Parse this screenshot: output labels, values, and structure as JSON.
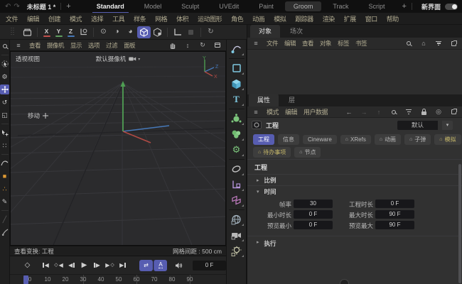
{
  "title_bar": {
    "doc_tab": "未标题 1 *",
    "add_tab": "+",
    "tabs": [
      "Standard",
      "Model",
      "Sculpt",
      "UVEdit",
      "Paint",
      "Groom",
      "Track",
      "Script"
    ],
    "add_layout": "+",
    "new_ui_label": "新界面"
  },
  "menu_bar": {
    "items": [
      "文件",
      "编辑",
      "创建",
      "模式",
      "选择",
      "工具",
      "样条",
      "网格",
      "体积",
      "运动图形",
      "角色",
      "动画",
      "模拟",
      "跟踪器",
      "渲染",
      "扩展",
      "窗口",
      "帮助"
    ]
  },
  "toolbar": {
    "axis_x": "X",
    "axis_y": "Y",
    "axis_z": "Z"
  },
  "viewport": {
    "menu": [
      "查看",
      "摄像机",
      "显示",
      "选项",
      "过滤",
      "面板"
    ],
    "view_label": "透视视图",
    "camera_label": "默认摄像机",
    "tool_hint": "移动",
    "gizmo": {
      "x": "X",
      "y": "Y",
      "z": "Z"
    },
    "status_left": "查看变换: 工程",
    "status_right": "网格间距 : 500 cm"
  },
  "object_manager": {
    "tabs": [
      "对象",
      "场次"
    ],
    "menu": [
      "文件",
      "编辑",
      "查看",
      "对象",
      "标签",
      "书签"
    ]
  },
  "attributes": {
    "tabs": [
      "属性",
      "层"
    ],
    "menu": [
      "模式",
      "编辑",
      "用户数据"
    ],
    "object_label": "工程",
    "preset_value": "默认",
    "mode_tabs": [
      "工程",
      "信息",
      "Cineware",
      "XRefs",
      "动画",
      "子弹",
      "模拟",
      "待办事项",
      "节点"
    ],
    "section_title": "工程",
    "group_scale": "比例",
    "group_time": "时间",
    "group_exec": "执行",
    "fields": {
      "fps_label": "帧率",
      "fps_value": "30",
      "proj_len_label": "工程时长",
      "proj_len_value": "0 F",
      "min_label": "最小时长",
      "min_value": "0 F",
      "max_label": "最大时长",
      "max_value": "90 F",
      "pre_min_label": "预览最小",
      "pre_min_value": "0 F",
      "pre_max_label": "预览最大",
      "pre_max_value": "90 F"
    }
  },
  "timeline": {
    "frame_value": "0 F",
    "ticks": [
      "0",
      "10",
      "20",
      "30",
      "40",
      "50",
      "60",
      "70",
      "80",
      "90"
    ]
  },
  "icons": {
    "undo": "↶",
    "redo": "↷",
    "hamburger": "≡",
    "home": "⌂",
    "gear": "⚙",
    "rotate": "↺",
    "rotate_cw": "↻",
    "dolly": "↕",
    "back": "←",
    "forward": "→",
    "up": "↑",
    "target": "◎",
    "dropdown": "▾",
    "collapsed": "▸",
    "expanded": "▾",
    "play": "▶",
    "rev": "◀",
    "diamond": "◇",
    "key_diamond": "◆",
    "loop": "⇄",
    "circle_dot": "⊙",
    "circle_half": "◑",
    "circle_most": "◕",
    "scale_sq": "◱",
    "dots": "∷",
    "therefore": "∴",
    "pencil": "✎",
    "square": "■",
    "slash": "╱",
    "autokey": "A",
    "camera_arrow": "▾",
    "tab_house": "⌂"
  },
  "colors": {
    "accent": "#575db1",
    "axis_x": "#c0504c",
    "axis_y": "#5f9e5f",
    "axis_z": "#4678b8",
    "warn_yellow": "#c9ba6a",
    "panel_bg": "#2a2a2a",
    "viewport_bg": "#2b2b2d"
  }
}
